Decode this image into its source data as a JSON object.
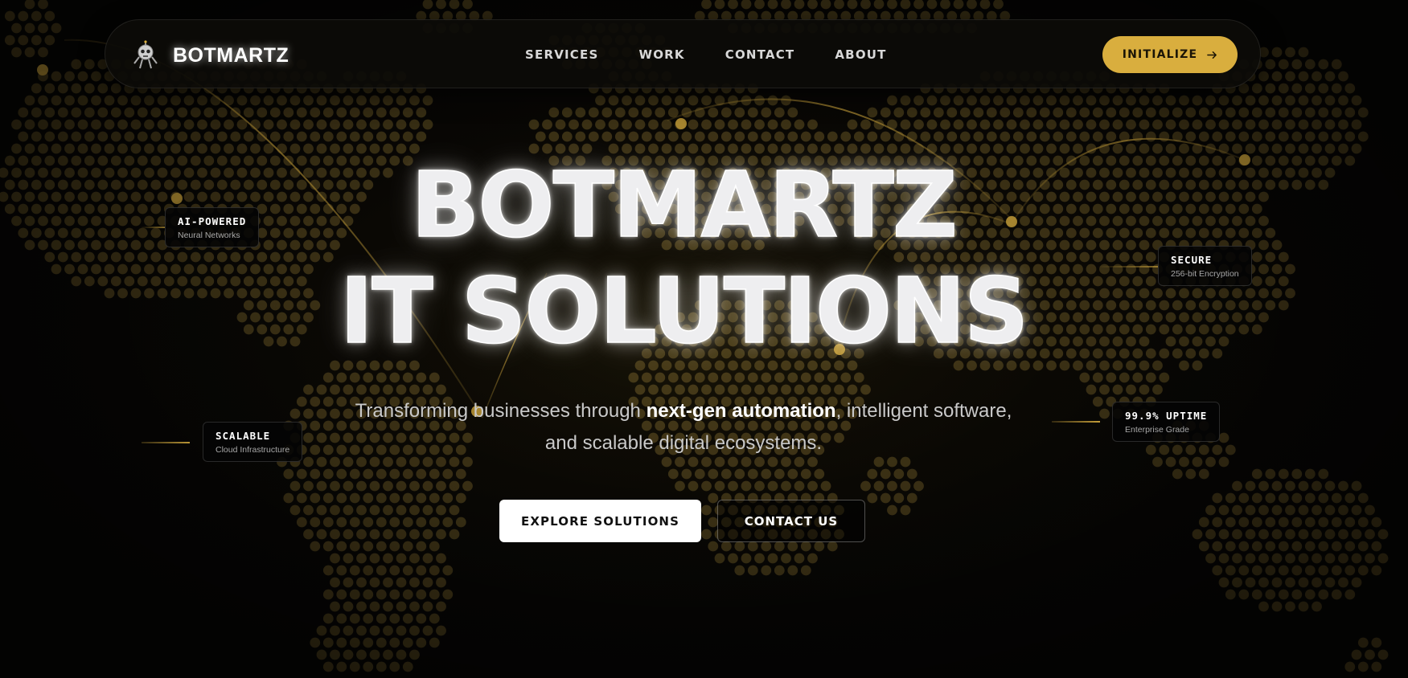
{
  "colors": {
    "accent": "#d9ae3e",
    "map_dot": "#6e5a26",
    "background": "#070605"
  },
  "nav": {
    "brand_name": "BOTMARTZ",
    "logo_icon": "robot-icon",
    "links": [
      "SERVICES",
      "WORK",
      "CONTACT",
      "ABOUT"
    ],
    "cta_label": "INITIALIZE",
    "cta_icon": "arrow-right-icon"
  },
  "hero": {
    "title_line1": "BOTMARTZ",
    "title_line2": "IT SOLUTIONS",
    "subtitle_pre": "Transforming businesses through ",
    "subtitle_highlight": "next-gen automation",
    "subtitle_post": ", intelligent software, and scalable digital ecosystems.",
    "primary_button": "EXPLORE SOLUTIONS",
    "secondary_button": "CONTACT US"
  },
  "badges": {
    "ai": {
      "title": "AI-POWERED",
      "subtitle": "Neural Networks"
    },
    "secure": {
      "title": "SECURE",
      "subtitle": "256-bit Encryption"
    },
    "scalable": {
      "title": "SCALABLE",
      "subtitle": "Cloud Infrastructure"
    },
    "uptime": {
      "title": "99.9% UPTIME",
      "subtitle": "Enterprise Grade"
    }
  }
}
